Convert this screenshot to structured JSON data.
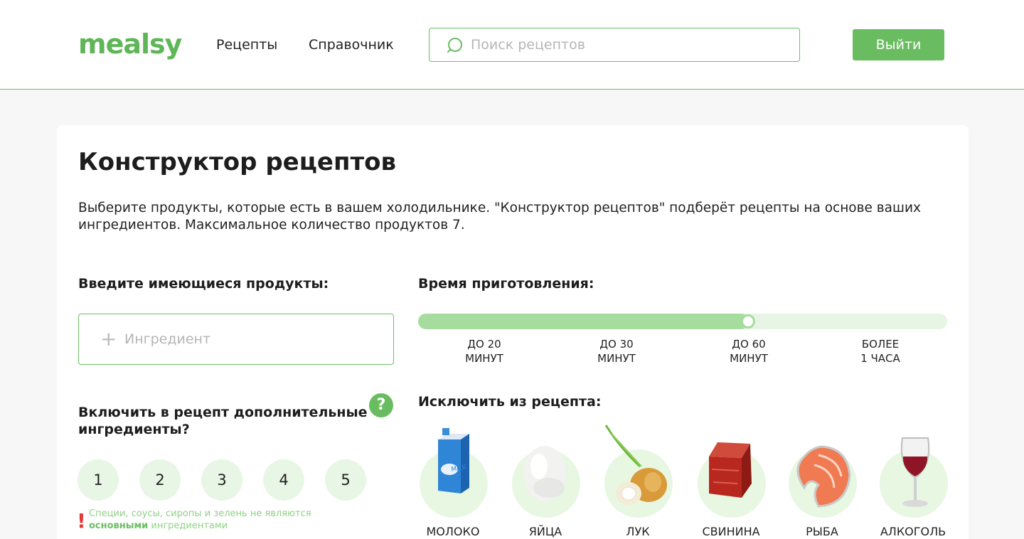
{
  "header": {
    "logo": "mealsy",
    "nav": {
      "recipes": "Рецепты",
      "reference": "Справочник"
    },
    "search_placeholder": "Поиск рецептов",
    "logout_label": "Выйти"
  },
  "main": {
    "title": "Конструктор рецептов",
    "description": "Выберите продукты, которые есть в вашем холодильнике. \"Конструктор рецептов\" подберёт рецепты на основе ваших ингредиентов. Максимальное количество продуктов 7.",
    "products_label": "Введите имеющиеся продукты:",
    "ingredient_placeholder": "Ингредиент",
    "extra_label": "Включить в рецепт дополнительные ингредиенты?",
    "help_label": "?",
    "counts": [
      "1",
      "2",
      "3",
      "4",
      "5"
    ],
    "warning_prefix": "Специи, соусы, сиропы и зелень не являются ",
    "warning_bold": "основными",
    "warning_suffix": " ингредиентами",
    "warning_mark": "!",
    "time_label": "Время приготовления:",
    "time_options": [
      {
        "line1": "до 20",
        "line2": "минут"
      },
      {
        "line1": "до 30",
        "line2": "минут"
      },
      {
        "line1": "до 60",
        "line2": "минут"
      },
      {
        "line1": "более",
        "line2": "1 часа"
      }
    ],
    "time_selected_index": 2,
    "exclude_label": "Исключить из рецепта:",
    "exclude_items": [
      {
        "label": "молоко",
        "icon": "milk-carton-icon"
      },
      {
        "label": "яйца",
        "icon": "egg-icon"
      },
      {
        "label": "лук",
        "icon": "onion-icon"
      },
      {
        "label": "свинина",
        "icon": "pork-icon"
      },
      {
        "label": "рыба",
        "icon": "fish-steak-icon"
      },
      {
        "label": "алкоголь",
        "icon": "wine-glass-icon"
      }
    ]
  },
  "colors": {
    "accent": "#69bd60",
    "accent_light": "#e7f5e4",
    "slider_fill": "#a6dd9e",
    "warning": "#e53935"
  }
}
